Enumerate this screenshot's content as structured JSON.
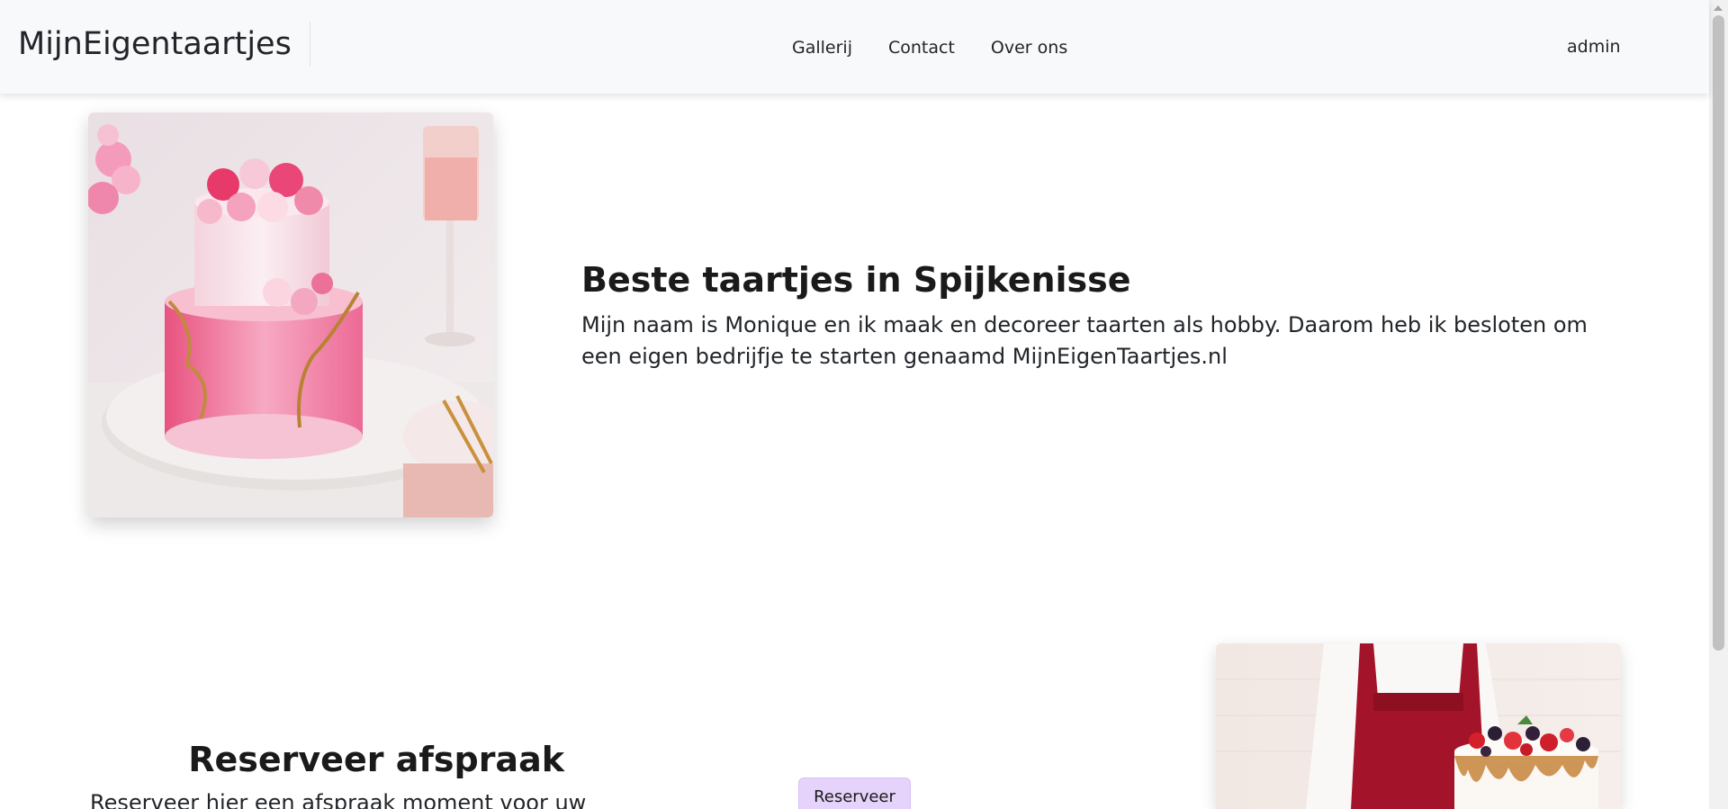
{
  "navbar": {
    "brand": "MijnEigentaartjes",
    "links": [
      "Gallerij",
      "Contact",
      "Over ons"
    ],
    "user": "admin"
  },
  "hero": {
    "heading": "Beste taartjes in Spijkenisse",
    "text": "Mijn naam is Monique en ik maak en decoreer taarten als hobby. Daarom heb ik besloten om een eigen bedrijfje te starten genaamd MijnEigenTaartjes.nl"
  },
  "reserve": {
    "heading": "Reserveer afspraak",
    "text": "Reserveer hier een afspraak moment voor uw",
    "button_label": "Reserveer"
  },
  "colors": {
    "navbar_bg": "#f8f9fa",
    "button_bg": "#e6d3fb",
    "cake_pink": "#f07aa6",
    "apron_red": "#a3142a"
  },
  "icons": {
    "hero_image": "pink-rose-cake-image",
    "section_image": "baker-with-berry-cake-image"
  }
}
